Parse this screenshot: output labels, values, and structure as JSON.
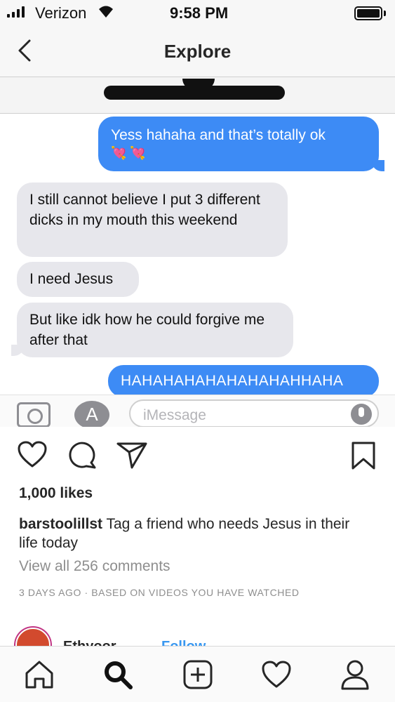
{
  "status_bar": {
    "carrier": "Verizon",
    "time": "9:58 PM",
    "signal_bars": 4,
    "battery_level": 1.0
  },
  "header": {
    "title": "Explore"
  },
  "messages": [
    {
      "from": "sent",
      "text": "Yess hahaha and that’s totally ok",
      "emoji": "💘 💘"
    },
    {
      "from": "received",
      "text": "I still cannot believe I put 3 different dicks in my mouth this weekend"
    },
    {
      "from": "received",
      "text": "I need Jesus"
    },
    {
      "from": "received",
      "text": "But like idk how he could forgive me after that"
    },
    {
      "from": "sent",
      "text": "HAHAHAHAHAHAHAHAHHAHA"
    }
  ],
  "compose": {
    "placeholder": "iMessage"
  },
  "post": {
    "likes": "1,000 likes",
    "username": "barstoolillst",
    "caption": "Tag a friend who needs Jesus in their life today",
    "view_comments": "View all 256 comments",
    "meta": "3 DAYS AGO · BASED ON VIDEOS YOU HAVE WATCHED"
  },
  "next_post": {
    "name": "Ethyoor",
    "follow": "Follow"
  },
  "icons": [
    "back-chevron-icon",
    "heart-icon",
    "comment-icon",
    "share-icon",
    "bookmark-icon",
    "home-icon",
    "search-icon",
    "new-post-icon",
    "activity-heart-icon",
    "profile-icon"
  ],
  "colors": {
    "sent_bubble": "#3d8bf5",
    "received_bubble": "#e7e7ec",
    "link_blue": "#3897f0",
    "muted": "#8e8e8e"
  }
}
